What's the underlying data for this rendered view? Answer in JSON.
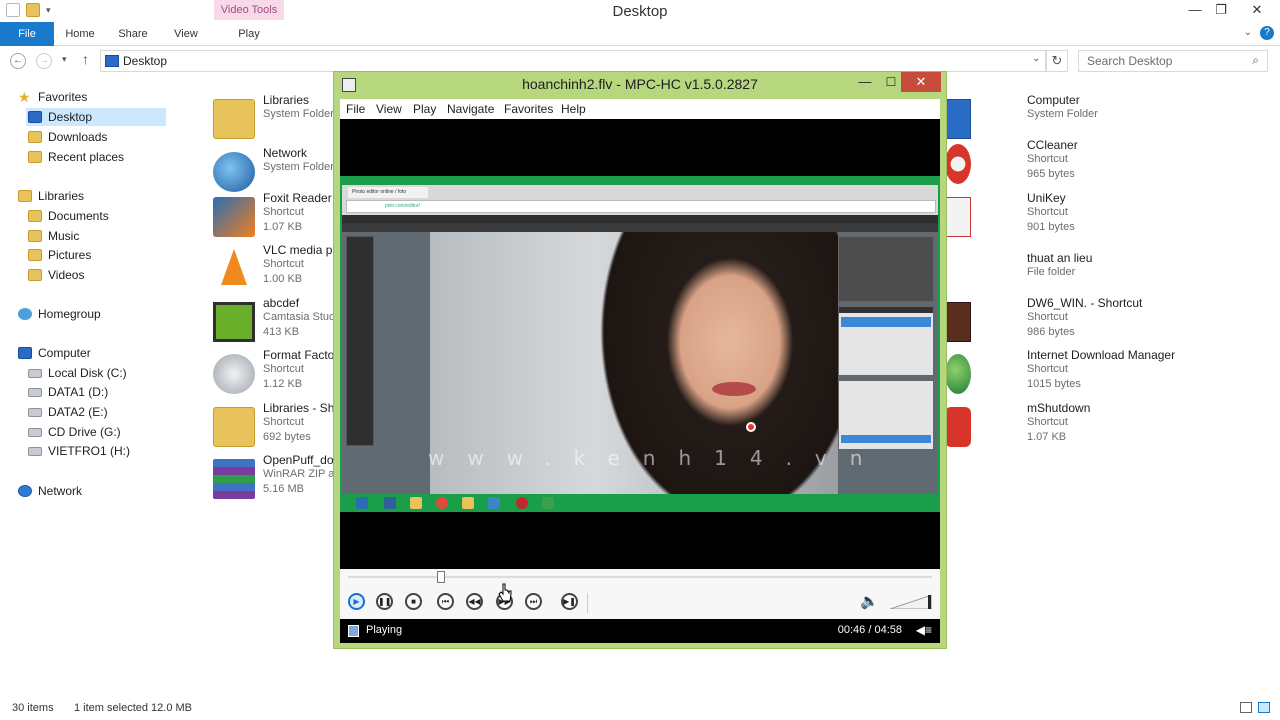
{
  "explorer": {
    "title": "Desktop",
    "context_tab": "Video Tools",
    "ribbon_tabs": [
      "File",
      "Home",
      "Share",
      "View",
      "Play"
    ],
    "address": "Desktop",
    "search_placeholder": "Search Desktop",
    "nav": {
      "favorites": "Favorites",
      "desktop": "Desktop",
      "downloads": "Downloads",
      "recent": "Recent places",
      "libraries": "Libraries",
      "documents": "Documents",
      "music": "Music",
      "pictures": "Pictures",
      "videos": "Videos",
      "homegroup": "Homegroup",
      "computer": "Computer",
      "local_c": "Local Disk (C:)",
      "data1": "DATA1 (D:)",
      "data2": "DATA2 (E:)",
      "cd": "CD Drive (G:)",
      "vietfro": "VIETFRO1 (H:)",
      "network": "Network"
    },
    "files_left": [
      {
        "name": "Libraries",
        "type": "System Folder",
        "size": ""
      },
      {
        "name": "Network",
        "type": "System Folder",
        "size": ""
      },
      {
        "name": "Foxit Reader",
        "type": "Shortcut",
        "size": "1.07 KB"
      },
      {
        "name": "VLC media pla",
        "type": "Shortcut",
        "size": "1.00 KB"
      },
      {
        "name": "abcdef",
        "type": "Camtasia Stud",
        "size": "413 KB"
      },
      {
        "name": "Format Factor",
        "type": "Shortcut",
        "size": "1.12 KB"
      },
      {
        "name": "Libraries - Sho",
        "type": "Shortcut",
        "size": "692 bytes"
      },
      {
        "name": "OpenPuff_dov",
        "type": "WinRAR ZIP ar",
        "size": "5.16 MB"
      }
    ],
    "files_right": [
      {
        "name": "Computer",
        "type": "System Folder",
        "size": ""
      },
      {
        "name": "CCleaner",
        "type": "Shortcut",
        "size": "965 bytes"
      },
      {
        "name": "UniKey",
        "type": "Shortcut",
        "size": "901 bytes"
      },
      {
        "name": "thuat an lieu",
        "type": "File folder",
        "size": ""
      },
      {
        "name": "DW6_WIN. - Shortcut",
        "type": "Shortcut",
        "size": "986 bytes"
      },
      {
        "name": "Internet Download Manager",
        "type": "Shortcut",
        "size": "1015 bytes"
      },
      {
        "name": "mShutdown",
        "type": "Shortcut",
        "size": "1.07 KB"
      }
    ],
    "status_count": "30 items",
    "status_selection": "1 item selected  12.0 MB"
  },
  "mpc": {
    "title": "hoanchinh2.flv - MPC-HC v1.5.0.2827",
    "menu": [
      "File",
      "View",
      "Play",
      "Navigate",
      "Favorites",
      "Help"
    ],
    "watermark": "www.kenh14.vn",
    "seek_fraction": 0.16,
    "status": "Playing",
    "time": "00:46 / 04:58",
    "video_browser_tab": "Photo editor online / foto",
    "video_browser_url": "pixlr.com/editor/"
  },
  "colors": {
    "explorer_accent": "#1979ca",
    "mpc_frame": "#b7d77e",
    "mpc_close": "#c74c3c",
    "video_taskbar": "#1b9e4a"
  }
}
